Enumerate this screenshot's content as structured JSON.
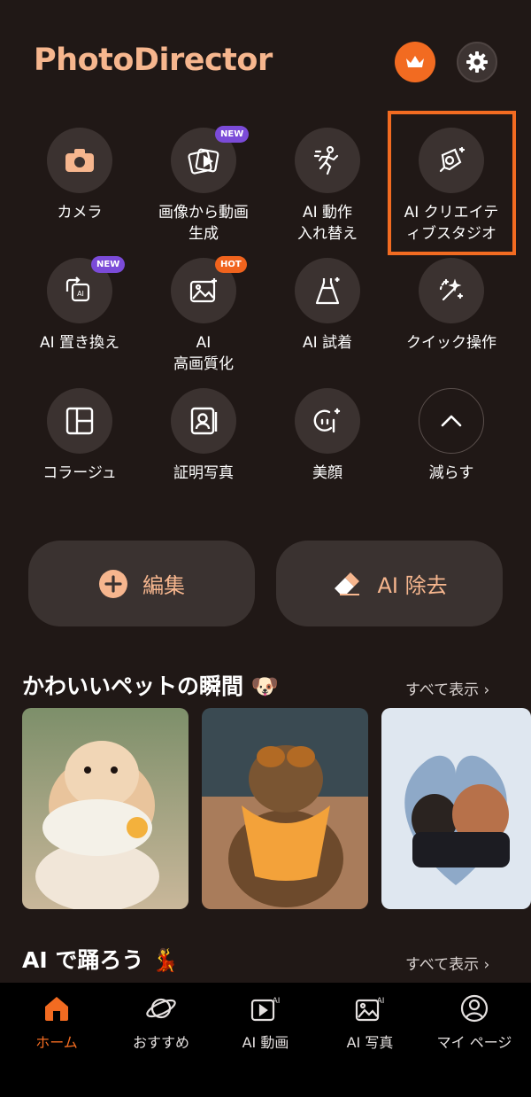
{
  "app": {
    "title": "PhotoDirector"
  },
  "tools": [
    {
      "label": "カメラ",
      "icon": "camera-icon"
    },
    {
      "label": "画像から動画\n生成",
      "icon": "image-to-video-icon",
      "badge": "NEW"
    },
    {
      "label": "AI 動作\n入れ替え",
      "icon": "motion-swap-icon"
    },
    {
      "label": "AI クリエイテ\nィブスタジオ",
      "icon": "creative-studio-icon"
    },
    {
      "label": "AI 置き換え",
      "icon": "ai-replace-icon",
      "badge": "NEW"
    },
    {
      "label": "AI\n高画質化",
      "icon": "ai-enhance-icon",
      "badge": "HOT"
    },
    {
      "label": "AI 試着",
      "icon": "dress-icon"
    },
    {
      "label": "クイック操作",
      "icon": "magic-wand-icon"
    },
    {
      "label": "コラージュ",
      "icon": "collage-icon"
    },
    {
      "label": "証明写真",
      "icon": "id-photo-icon"
    },
    {
      "label": "美顔",
      "icon": "beauty-face-icon"
    },
    {
      "label": "減らす",
      "icon": "chevron-up-icon"
    }
  ],
  "actions": {
    "edit": "編集",
    "ai_remove": "AI 除去"
  },
  "sections": [
    {
      "title": "かわいいペットの瞬間 🐶",
      "see_all": "すべて表示 ›"
    },
    {
      "title": "AI で踊ろう 💃",
      "see_all": "すべて表示 ›"
    }
  ],
  "nav": [
    {
      "label": "ホーム",
      "icon": "home-icon"
    },
    {
      "label": "おすすめ",
      "icon": "planet-icon"
    },
    {
      "label": "AI 動画",
      "icon": "ai-video-icon"
    },
    {
      "label": "AI 写真",
      "icon": "ai-photo-icon"
    },
    {
      "label": "マイ ページ",
      "icon": "profile-icon"
    }
  ],
  "colors": {
    "accent": "#f26b21",
    "peach": "#f6b68e",
    "background": "#201816"
  }
}
